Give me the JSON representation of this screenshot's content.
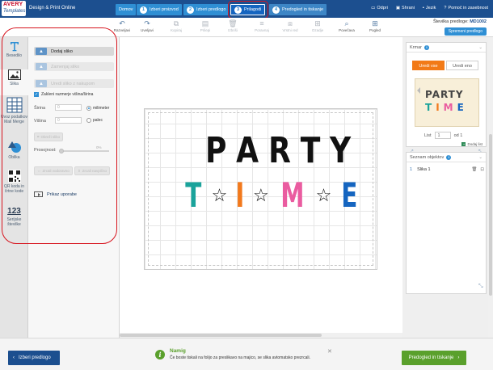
{
  "app": {
    "logo_line1": "AVERY",
    "logo_line2": "Templates",
    "title": "Design & Print Online"
  },
  "steps": [
    {
      "num": "",
      "label": "Domov"
    },
    {
      "num": "1",
      "label": "Izberi proizvod"
    },
    {
      "num": "2",
      "label": "Izberi predlogo"
    },
    {
      "num": "3",
      "label": "Prilagodi"
    },
    {
      "num": "4",
      "label": "Predogled in tiskanje"
    }
  ],
  "top_links": {
    "open": "Odpri",
    "save": "Shrani",
    "language": "Jezik",
    "help": "Pomoč in zasebnost"
  },
  "toolbar": {
    "tools": [
      {
        "icon": "undo-icon",
        "glyph": "↶",
        "label": "Razveljavi"
      },
      {
        "icon": "redo-icon",
        "glyph": "↷",
        "label": "Uveljavi"
      },
      {
        "icon": "copy-icon",
        "glyph": "⧉",
        "label": "Kopiraj"
      },
      {
        "icon": "paste-icon",
        "glyph": "▤",
        "label": "Prilepi"
      },
      {
        "icon": "delete-icon",
        "glyph": "🗑",
        "label": "Izbriši"
      },
      {
        "icon": "align-icon",
        "glyph": "≡",
        "label": "Poravnaj"
      },
      {
        "icon": "layer-order-icon",
        "glyph": "⧈",
        "label": "Vrstni red"
      },
      {
        "icon": "center-icon",
        "glyph": "⊞",
        "label": "Ozadje"
      },
      {
        "icon": "zoom-icon",
        "glyph": "⌕",
        "label": "Povečava"
      },
      {
        "icon": "grid-icon",
        "glyph": "⊞",
        "label": "Pogled"
      }
    ],
    "template_label": "Številka predloge:",
    "template_number": "MD1002",
    "save_template": "Spremeni predlogo"
  },
  "rail": [
    {
      "icon": "text-icon",
      "label": "Besedilo"
    },
    {
      "icon": "image-icon",
      "label": "Slika"
    },
    {
      "icon": "spreadsheet-icon",
      "label": "Uvoz podatkov Mail Merge"
    },
    {
      "icon": "shapes-icon",
      "label": "Oblika"
    },
    {
      "icon": "qr-code-icon",
      "label": "QR koda in črtne kode"
    },
    {
      "icon": "numbering-icon",
      "label": "Serijske številke",
      "glyph": "123"
    }
  ],
  "panel": {
    "add_image": "Dodaj sliko",
    "replace_image": "Zamenjaj sliko",
    "edit_image": "Uredi sliko z nakupom",
    "lock_ratio": "Zakleni razmerje višina/širina",
    "width_label": "Širina",
    "width_value": "0",
    "height_label": "Višina",
    "height_value": "0",
    "unit_mm": "milimeter",
    "unit_inch": "palec",
    "crop": "Obreži sliko",
    "opacity_label": "Prosojnost:",
    "opacity_value": "0%",
    "flip_h": "Zrcali vodoravno",
    "flip_v": "Zrcali navpično",
    "tutorial": "Prikaz uporabe"
  },
  "design": {
    "line1": [
      "P",
      "A",
      "R",
      "T",
      "Y"
    ],
    "line2": [
      {
        "t": "T",
        "c": "#1aa39b"
      },
      {
        "t": "☆",
        "c": "#111111"
      },
      {
        "t": "I",
        "c": "#f2791c"
      },
      {
        "t": "☆",
        "c": "#111111"
      },
      {
        "t": "M",
        "c": "#ea5ca0"
      },
      {
        "t": "☆",
        "c": "#111111"
      },
      {
        "t": "E",
        "c": "#1565c0"
      }
    ]
  },
  "right": {
    "navigator_title": "Krmar",
    "edit_all": "Uredi vse",
    "edit_one": "Uredi eno",
    "thumb_line1": "PARTY",
    "thumb_line2": "TIME",
    "sheet_label": "List",
    "sheet_value": "1",
    "sheet_of": "od 1",
    "add_sheet": "Dodaj list",
    "objects_title": "Seznam objektov",
    "object_index": "1",
    "object_name": "Slika 1"
  },
  "bottom": {
    "back": "Izberi predlogo",
    "next": "Predogled in tiskanje",
    "tip_title": "Namig",
    "tip_text": "Če boste tiskali na folijo za preslikavo na majico, se slika avtomatsko prezrcali."
  },
  "colors": {
    "header": "#1c4f8f",
    "step": "#2f8fd4",
    "accent_orange": "#f27a17",
    "next_green": "#5aa02c",
    "annotation_red": "#d7141e"
  }
}
